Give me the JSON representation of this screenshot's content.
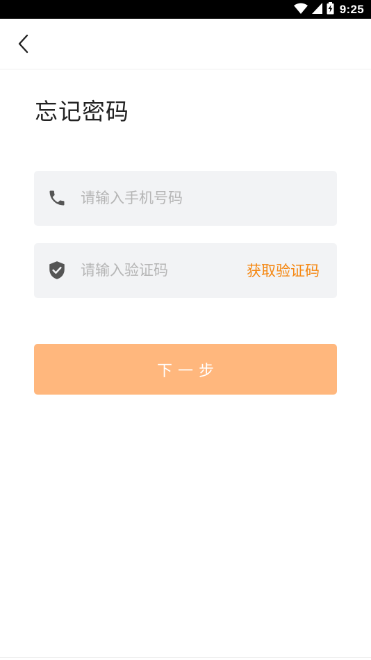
{
  "status_bar": {
    "time": "9:25",
    "icons": [
      "wifi-icon",
      "cell-signal-icon",
      "battery-charging-icon"
    ]
  },
  "nav": {
    "back_icon": "chevron-left-icon"
  },
  "title": "忘记密码",
  "phone_field": {
    "icon": "phone-icon",
    "placeholder": "请输入手机号码",
    "value": ""
  },
  "code_field": {
    "icon": "shield-check-icon",
    "placeholder": "请输入验证码",
    "value": "",
    "get_code_label": "获取验证码"
  },
  "next_button": {
    "label": "下一步"
  },
  "colors": {
    "accent": "#f5860f",
    "button_bg": "#ffb77d",
    "field_bg": "#f2f3f5",
    "status_bar_bg": "#000000"
  }
}
